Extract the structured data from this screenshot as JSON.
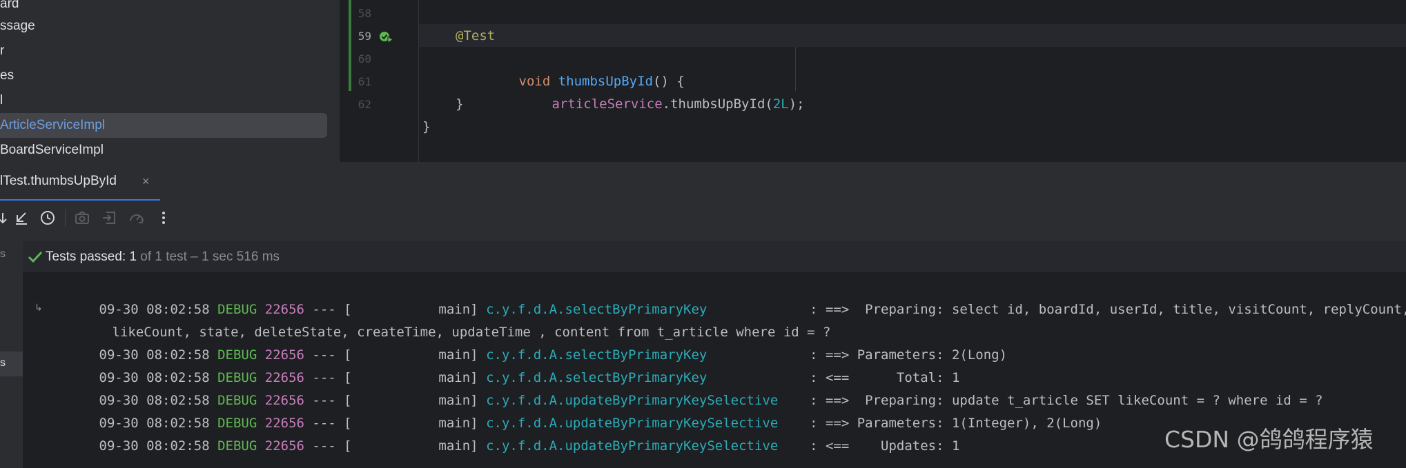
{
  "project_tree": {
    "items": [
      {
        "label": "ard",
        "selected": false
      },
      {
        "label": "ssage",
        "selected": false
      },
      {
        "label": "r",
        "selected": false
      },
      {
        "label": "es",
        "selected": false
      },
      {
        "label": "l",
        "selected": false
      },
      {
        "label": "ArticleServiceImpl",
        "selected": true
      },
      {
        "label": "BoardServiceImpl",
        "selected": false
      }
    ]
  },
  "editor": {
    "line_numbers": [
      "58",
      "59",
      "60",
      "61",
      "62"
    ],
    "current_line": "59",
    "code": {
      "line58": {
        "annotation": "@Test"
      },
      "line59": {
        "keyword": "void",
        "method": "thumbsUpById",
        "rest": "() {"
      },
      "line60": {
        "field": "articleService",
        "call": ".thumbsUpById(",
        "number": "2L",
        "end": ");"
      },
      "line61": {
        "text": "}"
      },
      "line62": {
        "text": "}"
      }
    }
  },
  "run_panel": {
    "tab_label": "lTest.thumbsUpById",
    "tab_close": "×",
    "toolbar_icons": [
      "rerun-icon",
      "export-icon",
      "history-icon",
      "screenshot-icon",
      "import-icon",
      "coverage-icon",
      "more-options-icon"
    ],
    "strip_labels": [
      "s",
      "s"
    ],
    "status": {
      "passed": "Tests passed: 1",
      "detail": " of 1 test – 1 sec 516 ms"
    },
    "log_lines": [
      {
        "ts": "09-30 08:02:58 ",
        "level": "DEBUG",
        "pid": " 22656",
        "thread": " --- [           main] ",
        "logger": "c.y.f.d.A.selectByPrimaryKey            ",
        "msg": " : ==>  Preparing: select id, boardId, userId, title, visitCount, replyCount,"
      },
      {
        "ts": "",
        "level": "",
        "pid": "",
        "thread": "",
        "logger": "",
        "msg": "likeCount, state, deleteState, createTime, updateTime , content from t_article where id = ?"
      },
      {
        "ts": "09-30 08:02:58 ",
        "level": "DEBUG",
        "pid": " 22656",
        "thread": " --- [           main] ",
        "logger": "c.y.f.d.A.selectByPrimaryKey            ",
        "msg": " : ==> Parameters: 2(Long)"
      },
      {
        "ts": "09-30 08:02:58 ",
        "level": "DEBUG",
        "pid": " 22656",
        "thread": " --- [           main] ",
        "logger": "c.y.f.d.A.selectByPrimaryKey            ",
        "msg": " : <==      Total: 1"
      },
      {
        "ts": "09-30 08:02:58 ",
        "level": "DEBUG",
        "pid": " 22656",
        "thread": " --- [           main] ",
        "logger": "c.y.f.d.A.updateByPrimaryKeySelective   ",
        "msg": " : ==>  Preparing: update t_article SET likeCount = ? where id = ?"
      },
      {
        "ts": "09-30 08:02:58 ",
        "level": "DEBUG",
        "pid": " 22656",
        "thread": " --- [           main] ",
        "logger": "c.y.f.d.A.updateByPrimaryKeySelective   ",
        "msg": " : ==> Parameters: 1(Integer), 2(Long)"
      },
      {
        "ts": "09-30 08:02:58 ",
        "level": "DEBUG",
        "pid": " 22656",
        "thread": " --- [           main] ",
        "logger": "c.y.f.d.A.updateByPrimaryKeySelective   ",
        "msg": " : <==    Updates: 1"
      }
    ]
  },
  "watermark": "CSDN @鸽鸽程序猿",
  "colors": {
    "background": "#1e1f22",
    "panel": "#2b2d30",
    "accent": "#3574f0",
    "success": "#5fb852",
    "log_logger": "#2aacb8",
    "log_pid": "#c77dbb"
  }
}
